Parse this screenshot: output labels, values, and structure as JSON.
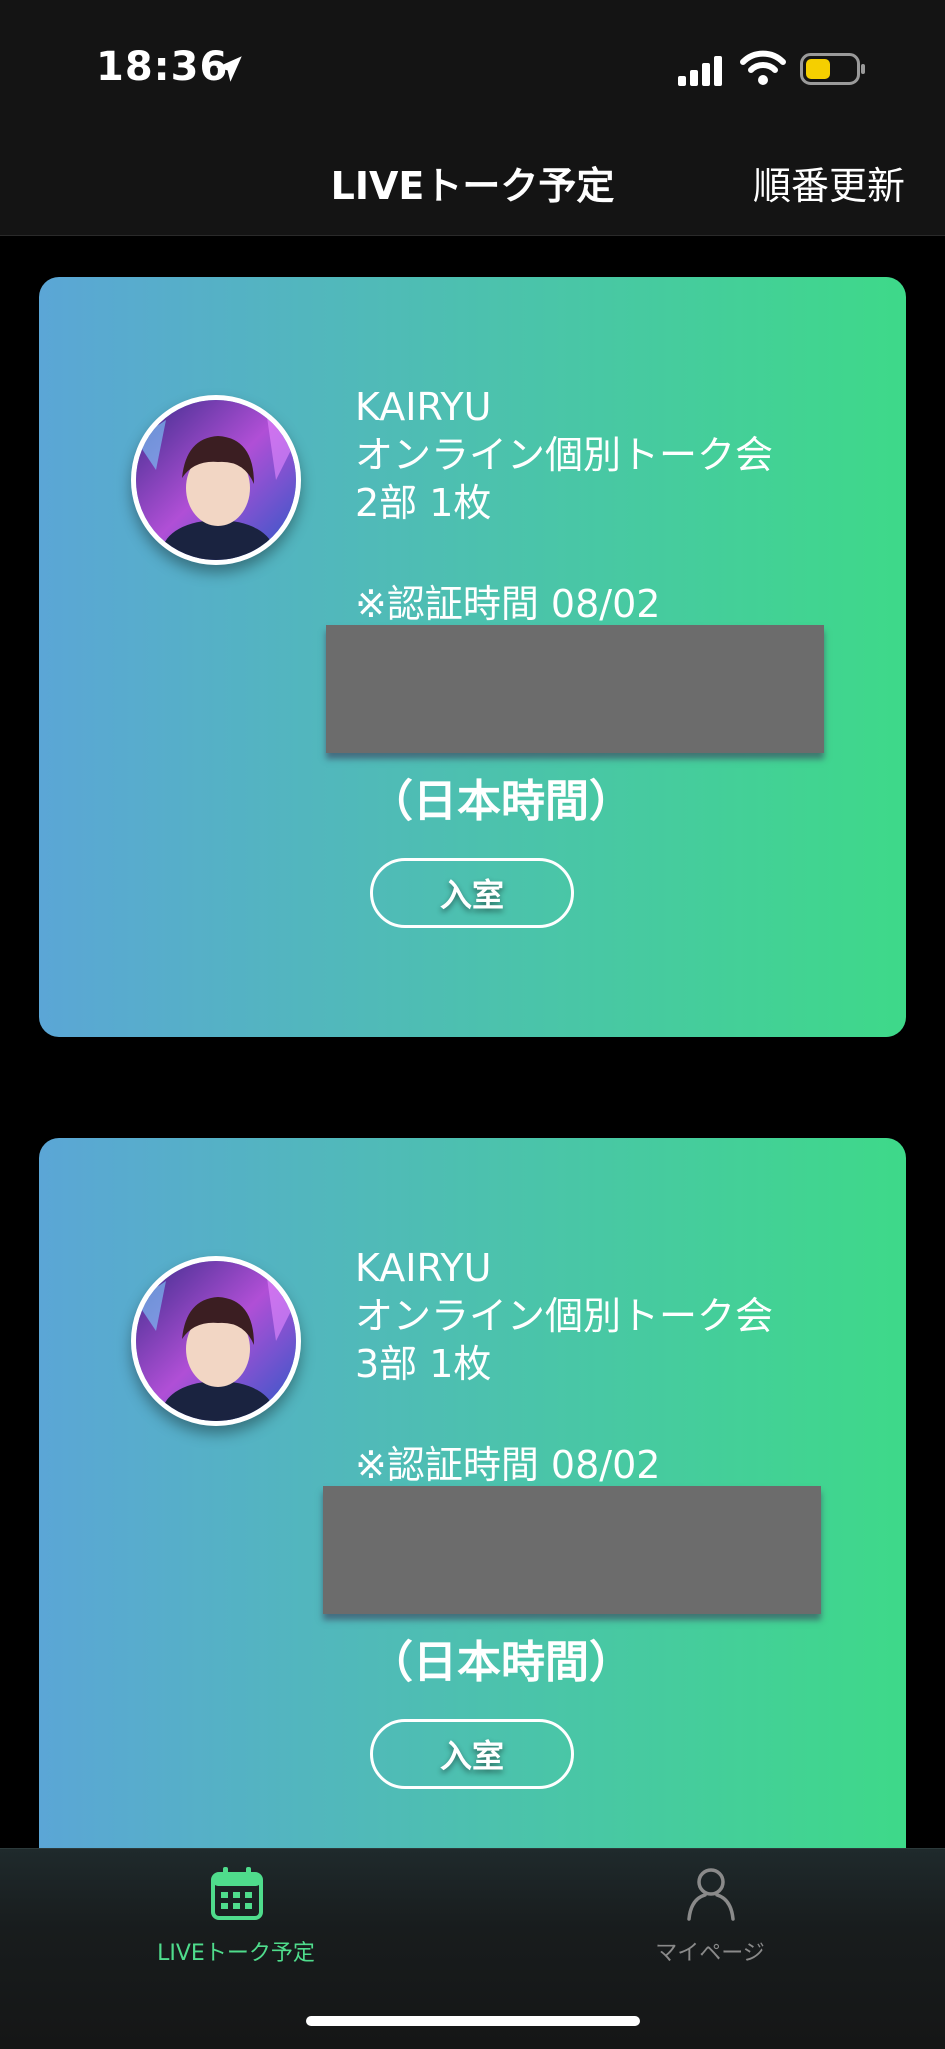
{
  "status_bar": {
    "time": "18:36",
    "battery_color": "#f5cf00"
  },
  "nav": {
    "title": "LIVEトーク予定",
    "action_label": "順番更新"
  },
  "cards": [
    {
      "artist": "KAIRYU",
      "event": "オンライン個別トーク会",
      "session": "2部 1枚",
      "auth_label": "※認証時間 08/02",
      "timezone": "（日本時間）",
      "enter_label": "入室"
    },
    {
      "artist": "KAIRYU",
      "event": "オンライン個別トーク会",
      "session": "3部 1枚",
      "auth_label": "※認証時間 08/02",
      "timezone": "（日本時間）",
      "enter_label": "入室"
    }
  ],
  "tabs": [
    {
      "label": "LIVEトーク予定",
      "icon": "calendar-icon",
      "active": true,
      "color": "#4fdc8c"
    },
    {
      "label": "マイページ",
      "icon": "person-icon",
      "active": false,
      "color": "#8a8a8a"
    }
  ],
  "colors": {
    "card_gradient_start": "#5ba6d6",
    "card_gradient_end": "#3ed989",
    "active_tab": "#4fdc8c"
  }
}
